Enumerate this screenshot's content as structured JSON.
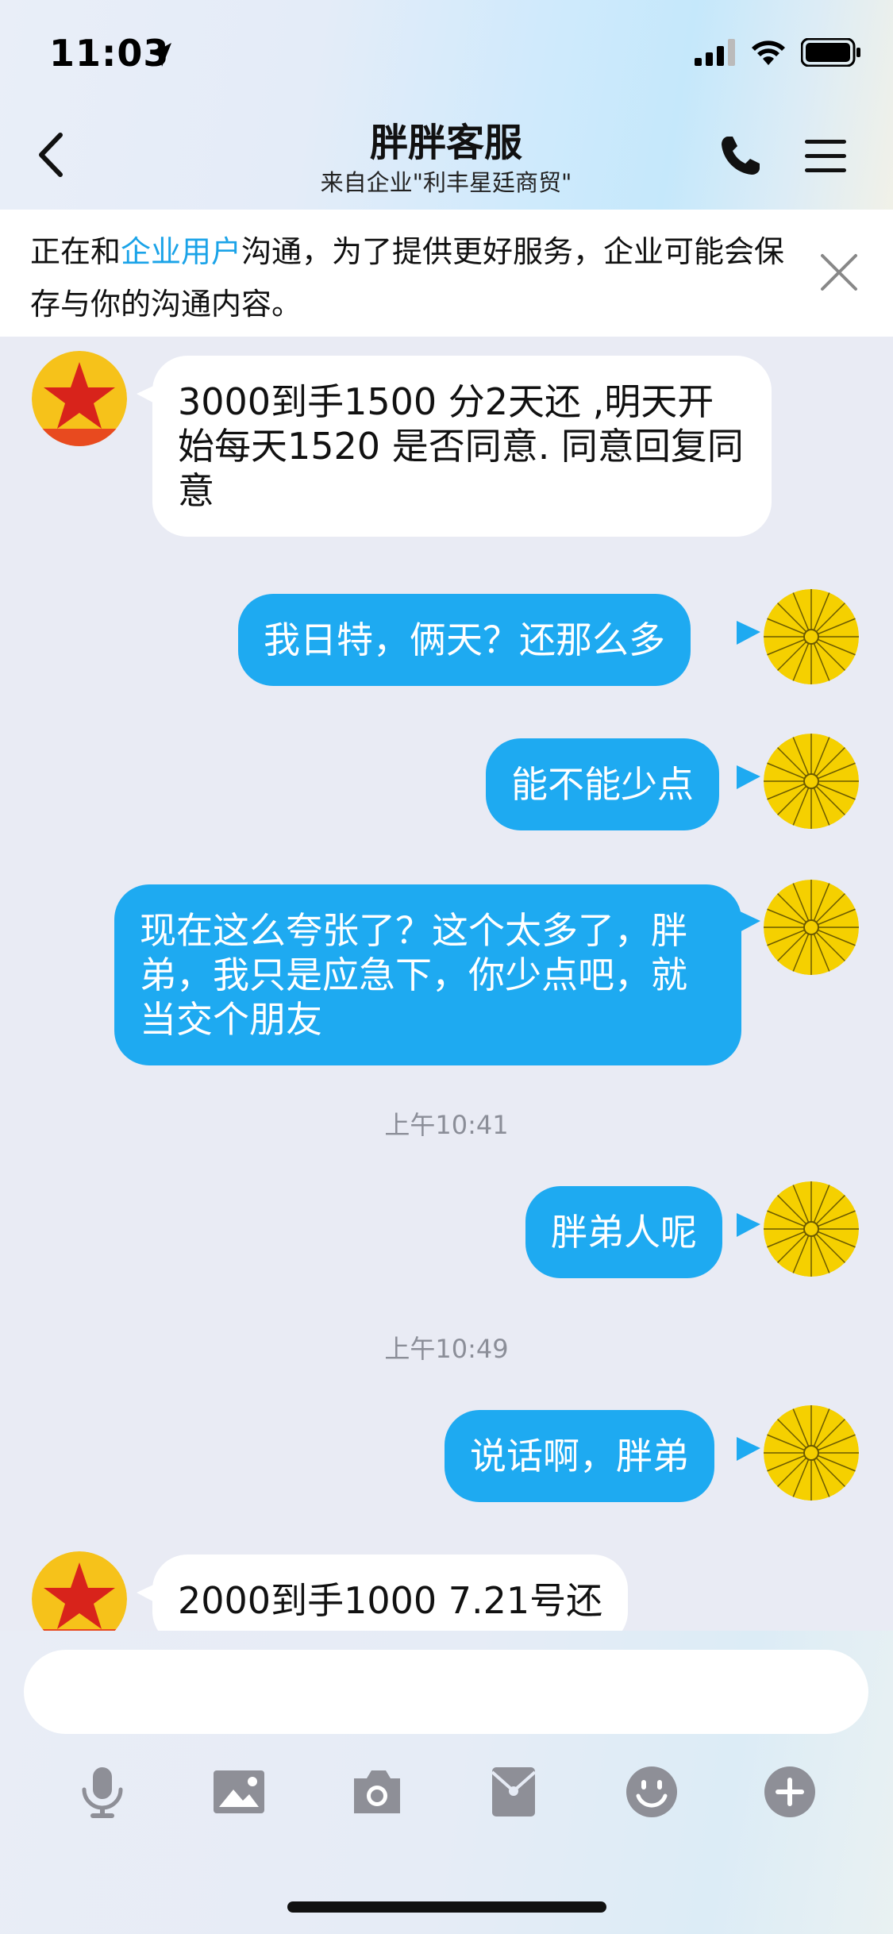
{
  "status_bar": {
    "time": "11:03"
  },
  "header": {
    "title": "胖胖客服",
    "subtitle": "来自企业\"利丰星廷商贸\""
  },
  "notice": {
    "text_before": "正在和",
    "highlight": "企业用户",
    "text_after": "沟通，为了提供更好服务，企业可能会保存与你的沟通内容。"
  },
  "messages": [
    {
      "side": "in",
      "text": "3000到手1500  分2天还 ,明天开始每天1520   是否同意. 同意回复同意"
    },
    {
      "side": "out",
      "text": "我日特，俩天？还那么多"
    },
    {
      "side": "out",
      "text": "能不能少点"
    },
    {
      "side": "out",
      "text": "现在这么夸张了？这个太多了，胖弟，我只是应急下，你少点吧，就当交个朋友"
    },
    {
      "side": "out",
      "text": "胖弟人呢"
    },
    {
      "side": "out",
      "text": "说话啊，胖弟"
    },
    {
      "side": "in",
      "text": "2000到手1000 7.21号还"
    }
  ],
  "timestamps": [
    "上午10:41",
    "上午10:49"
  ],
  "input": {
    "placeholder": ""
  },
  "toolbar": [
    "microphone-icon",
    "image-icon",
    "camera-icon",
    "red-packet-icon",
    "emoji-icon",
    "plus-icon"
  ],
  "colors": {
    "outgoing_bubble": "#1eaaf1",
    "link": "#1aa3e8",
    "avatar_yellow": "#f5d000"
  }
}
